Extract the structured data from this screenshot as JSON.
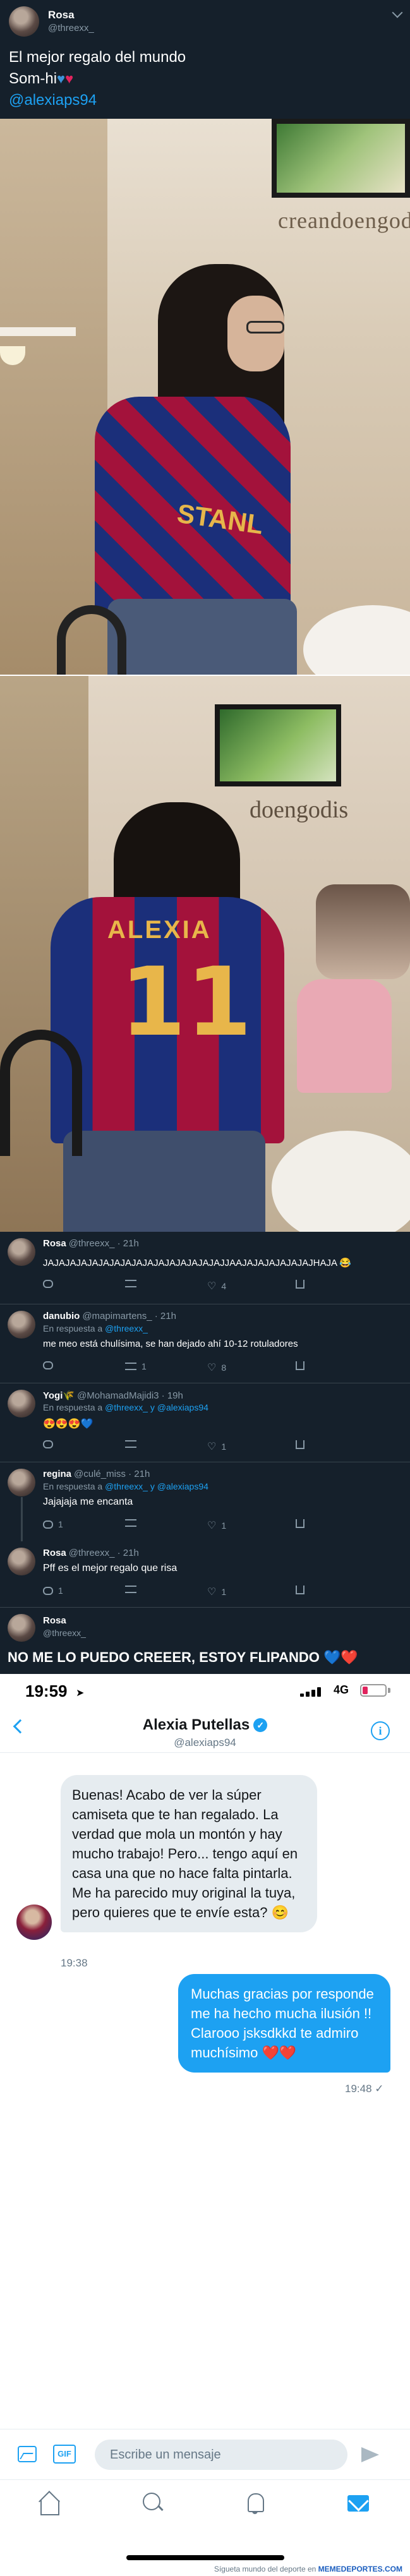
{
  "tweet": {
    "user_name": "Rosa",
    "user_handle": "@threexx_",
    "line1": "El mejor regalo del mundo",
    "line2": "Som-hi",
    "mention": "@alexiaps94"
  },
  "photos": {
    "photo1_sign": "creandoengodi",
    "shirt_front_text": "STANL",
    "photo2_sign": "doengodis",
    "shirt_back_name": "ALEXIA",
    "shirt_back_number": "11"
  },
  "replies": [
    {
      "name": "Rosa",
      "meta": "@threexx_ · 21h",
      "in_reply_prefix": "",
      "in_reply_to": "",
      "text": "JAJAJAJAJAJAJAJAJAJAJAJAJAJAJAJAJJAAJAJAJAJAJAJAJHAJA 😂",
      "counts": {
        "reply": "",
        "retweet": "",
        "like": "4"
      }
    },
    {
      "name": "danubio",
      "meta": "@mapimartens_ · 21h",
      "in_reply_prefix": "En respuesta a",
      "in_reply_to": "@threexx_",
      "text": "me meo está chulísima, se han dejado ahí 10-12 rotuladores",
      "counts": {
        "reply": "",
        "retweet": "1",
        "like": "8"
      }
    },
    {
      "name": "Yogi🌾",
      "meta": "@MohamadMajidi3 · 19h",
      "in_reply_prefix": "En respuesta a",
      "in_reply_to": "@threexx_ y @alexiaps94",
      "text": "😍😍😍💙",
      "counts": {
        "reply": "",
        "retweet": "",
        "like": "1"
      }
    },
    {
      "name": "regina",
      "meta": "@culé_miss · 21h",
      "in_reply_prefix": "En respuesta a",
      "in_reply_to": "@threexx_ y @alexiaps94",
      "text": "Jajajaja me encanta",
      "counts": {
        "reply": "1",
        "retweet": "",
        "like": "1"
      }
    },
    {
      "name": "Rosa",
      "meta": "@threexx_ · 21h",
      "in_reply_prefix": "",
      "in_reply_to": "",
      "text": "Pff es el mejor regalo que risa",
      "counts": {
        "reply": "1",
        "retweet": "",
        "like": "1"
      }
    }
  ],
  "last_reply": {
    "name": "Rosa",
    "handle": "@threexx_",
    "text": "NO ME LO PUEDO CREEER, ESTOY FLIPANDO 💙❤️"
  },
  "status_bar": {
    "time": "19:59",
    "network": "4G"
  },
  "dm": {
    "contact_name": "Alexia Putellas",
    "contact_handle": "@alexiaps94",
    "incoming": {
      "text": "Buenas! Acabo de ver la súper camiseta que te han regalado. La verdad que mola un montón y hay mucho trabajo! Pero... tengo aquí en casa una que no hace falta pintarla. Me ha parecido muy original la tuya, pero quieres que te envíe esta? 😊",
      "time": "19:38"
    },
    "outgoing": {
      "text": "Muchas gracias por responde me ha hecho mucha ilusión !! Clarooo jsksdkkd te admiro muchísimo ❤️❤️",
      "time": "19:48 ✓"
    },
    "composer_placeholder": "Escribe un mensaje",
    "gif_label": "GIF"
  },
  "watermark": {
    "prefix": "Sígueta mundo del deporte en",
    "brand": "MEMEDEPORTES.COM"
  },
  "colors": {
    "twitter_dark_bg": "#15202b",
    "twitter_blue": "#1da1f2",
    "heart_red": "#e0245e",
    "barca_blue": "#1b2f7a",
    "barca_red": "#a3123b"
  }
}
